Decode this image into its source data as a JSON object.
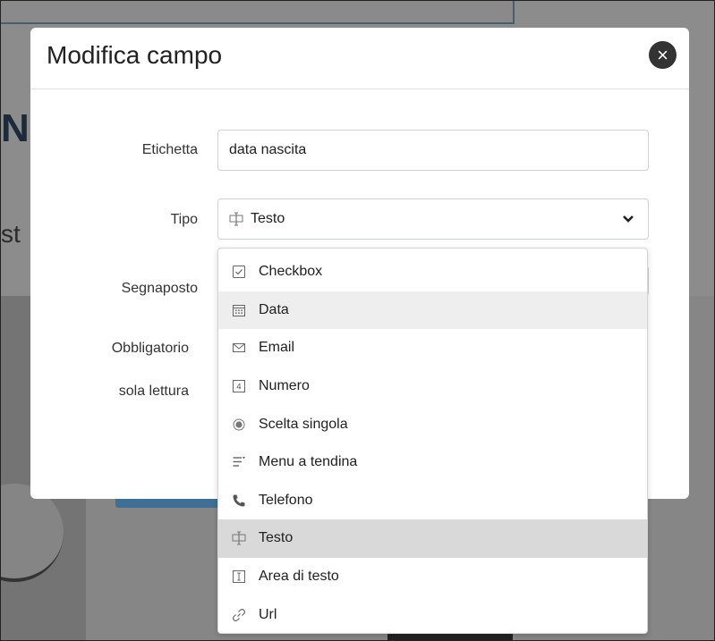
{
  "background": {
    "heading_fragment": "NE",
    "sub_fragment": "st"
  },
  "modal": {
    "title": "Modifica campo",
    "close_glyph": "×",
    "fields": {
      "label_label": "Etichetta",
      "label_value": "data nascita",
      "type_label": "Tipo",
      "type_value": "Testo",
      "type_icon": "text-cursor-icon",
      "placeholder_label": "Segnaposto",
      "required_label": "Obbligatorio",
      "readonly_label": "sola lettura"
    }
  },
  "dropdown": {
    "options": [
      {
        "label": "Checkbox",
        "icon": "checkbox-icon",
        "state": "normal"
      },
      {
        "label": "Data",
        "icon": "calendar-icon",
        "state": "hover"
      },
      {
        "label": "Email",
        "icon": "envelope-icon",
        "state": "normal"
      },
      {
        "label": "Numero",
        "icon": "number-icon",
        "state": "normal"
      },
      {
        "label": "Scelta singola",
        "icon": "radio-icon",
        "state": "normal"
      },
      {
        "label": "Menu a tendina",
        "icon": "dropdown-menu-icon",
        "state": "normal"
      },
      {
        "label": "Telefono",
        "icon": "phone-icon",
        "state": "normal"
      },
      {
        "label": "Testo",
        "icon": "text-cursor-icon",
        "state": "selected"
      },
      {
        "label": "Area di testo",
        "icon": "textarea-icon",
        "state": "normal"
      },
      {
        "label": "Url",
        "icon": "link-icon",
        "state": "normal"
      }
    ]
  },
  "colors": {
    "overlay": "#8c8c8c",
    "hover": "#eeeeee",
    "selected": "#d9d9d9",
    "close_button": "#333333"
  }
}
